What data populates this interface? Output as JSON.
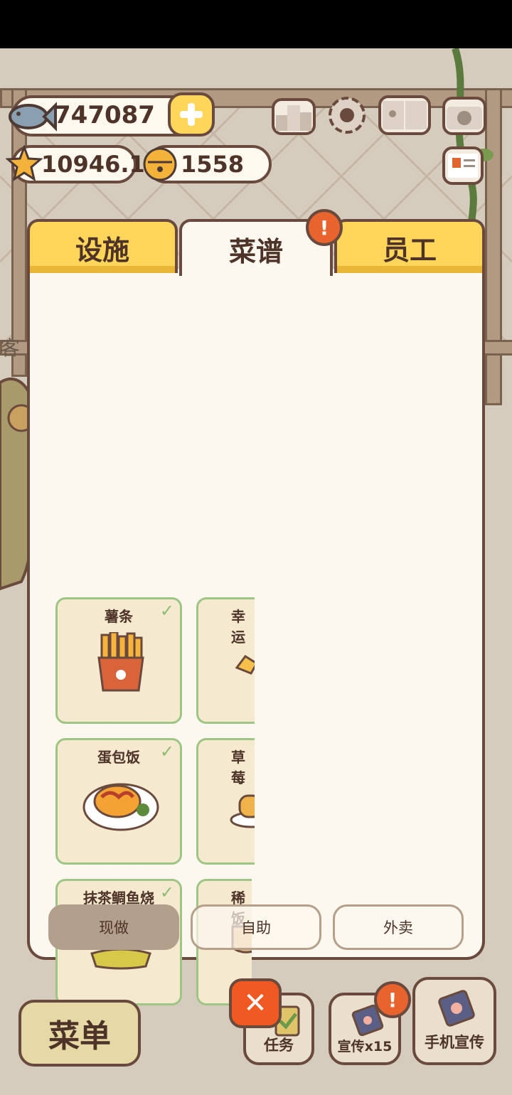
{
  "hud": {
    "fish_count": "747087",
    "star_rating": "10946.1",
    "bell_count": "1558"
  },
  "side_label": "客",
  "tabs": [
    {
      "label": "设施"
    },
    {
      "label": "菜谱"
    },
    {
      "label": "员工"
    }
  ],
  "tab_badge": "!",
  "recipes": [
    {
      "name": "薯条",
      "owned": true
    },
    {
      "name": "幸运",
      "owned": false
    },
    {
      "name": "蛋包饭",
      "owned": true
    },
    {
      "name": "草莓",
      "owned": false
    },
    {
      "name": "抹茶鲷鱼烧",
      "owned": true
    },
    {
      "name": "稀饭",
      "owned": false
    }
  ],
  "check_mark": "✓",
  "filters": [
    {
      "label": "现做",
      "selected": true
    },
    {
      "label": "自助",
      "selected": false
    },
    {
      "label": "外卖",
      "selected": false
    }
  ],
  "bottom": {
    "menu_label": "菜单",
    "tasks_label": "任务",
    "promo_label": "宣传x15",
    "phone_promo_label": "手机宣传",
    "close_glyph": "✕",
    "promo_badge": "!"
  },
  "colors": {
    "accent_yellow": "#ffd55a",
    "outline_brown": "#6a4a3c",
    "panel_bg": "#fdf8ef",
    "card_border_green": "#9fc585",
    "close_orange": "#f05a22"
  }
}
